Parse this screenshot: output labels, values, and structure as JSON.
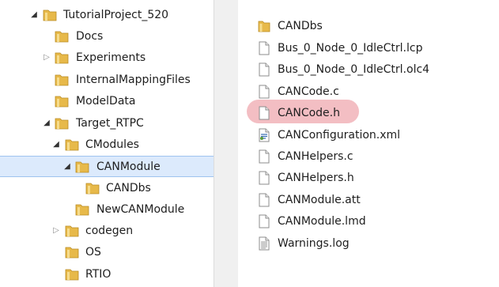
{
  "tree": [
    {
      "label": "TutorialProject_520",
      "expander": "expanded"
    },
    {
      "label": "Docs",
      "expander": "none"
    },
    {
      "label": "Experiments",
      "expander": "collapsed"
    },
    {
      "label": "InternalMappingFiles",
      "expander": "none"
    },
    {
      "label": "ModelData",
      "expander": "none"
    },
    {
      "label": "Target_RTPC",
      "expander": "expanded"
    },
    {
      "label": "CModules",
      "expander": "expanded"
    },
    {
      "label": "CANModule",
      "expander": "expanded",
      "selected": true
    },
    {
      "label": "CANDbs",
      "expander": "none"
    },
    {
      "label": "NewCANModule",
      "expander": "none"
    },
    {
      "label": "codegen",
      "expander": "collapsed"
    },
    {
      "label": "OS",
      "expander": "none"
    },
    {
      "label": "RTIO",
      "expander": "none"
    }
  ],
  "files": [
    {
      "label": "CANDbs",
      "icon": "folder-icon"
    },
    {
      "label": "Bus_0_Node_0_IdleCtrl.lcp",
      "icon": "file-icon"
    },
    {
      "label": "Bus_0_Node_0_IdleCtrl.olc4",
      "icon": "file-icon"
    },
    {
      "label": "CANCode.c",
      "icon": "file-icon"
    },
    {
      "label": "CANCode.h",
      "icon": "file-icon",
      "highlighted": true
    },
    {
      "label": "CANConfiguration.xml",
      "icon": "xml-file-icon"
    },
    {
      "label": "CANHelpers.c",
      "icon": "file-icon"
    },
    {
      "label": "CANHelpers.h",
      "icon": "file-icon"
    },
    {
      "label": "CANModule.att",
      "icon": "file-icon"
    },
    {
      "label": "CANModule.lmd",
      "icon": "file-icon"
    },
    {
      "label": "Warnings.log",
      "icon": "text-file-icon"
    }
  ],
  "colors": {
    "selection": "#dceafc",
    "highlight": "#f2b7bd",
    "folder": "#e7b94a"
  }
}
